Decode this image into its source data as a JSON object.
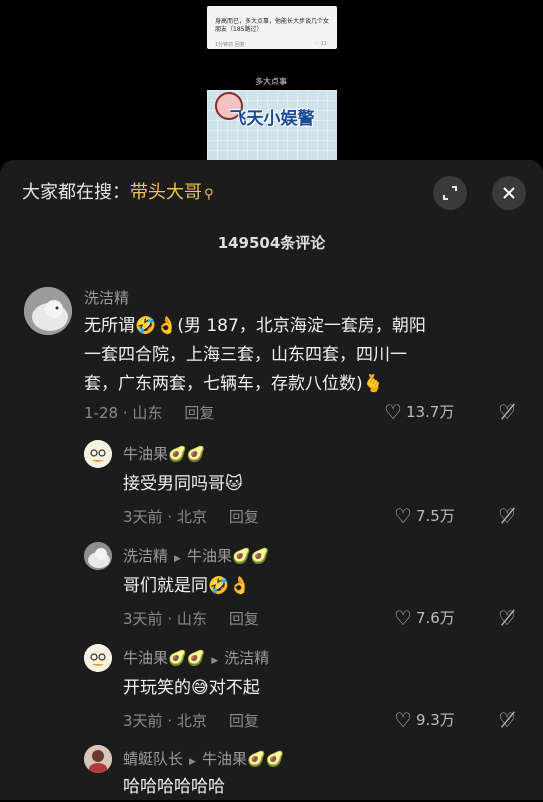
{
  "top_video": {
    "text": "身高而已，多大点事，他能长大步谈几个女朋友（185路过）",
    "meta": "1分钟前 回复",
    "likes": "11"
  },
  "second_video": {
    "label": "多大点事",
    "logo": "飞天小娱警"
  },
  "search": {
    "prefix": "大家都在搜：",
    "keyword": "带头大哥",
    "icon": "search-icon"
  },
  "header": {
    "comment_count": "149504条评论",
    "expand_icon": "expand-icon",
    "close_icon": "close-icon"
  },
  "comments": [
    {
      "user": "洗洁精",
      "reply_to": "",
      "text_line1": "无所谓🤣👌(男 187，北京海淀一套房，朝阳",
      "text_line2": "一套四合院，上海三套，山东四套，四川一",
      "text_line3": "套，广东两套，七辆车，存款八位数)🫰",
      "date": "1-28",
      "location": "山东",
      "reply_label": "回复",
      "likes": "13.7万"
    },
    {
      "user": "牛油果🥑🥑",
      "reply_to": "",
      "text": "接受男同吗哥🐱",
      "date": "3天前",
      "location": "北京",
      "reply_label": "回复",
      "likes": "7.5万"
    },
    {
      "user": "洗洁精",
      "reply_to": "牛油果🥑🥑",
      "text": "哥们就是同🤣👌",
      "date": "3天前",
      "location": "山东",
      "reply_label": "回复",
      "likes": "7.6万"
    },
    {
      "user": "牛油果🥑🥑",
      "reply_to": "洗洁精",
      "text": "开玩笑的😅对不起",
      "date": "3天前",
      "location": "北京",
      "reply_label": "回复",
      "likes": "9.3万"
    },
    {
      "user": "蜻蜓队长",
      "reply_to": "牛油果🥑🥑",
      "text": "哈哈哈哈哈哈"
    }
  ]
}
